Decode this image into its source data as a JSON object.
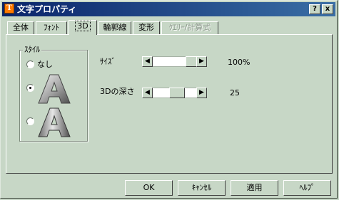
{
  "window": {
    "title": "文字プロパティ",
    "icon_name": "app-text-icon",
    "help_btn": "?",
    "close_btn": "x"
  },
  "tabs": [
    {
      "label": "全体"
    },
    {
      "label": "ﾌｫﾝﾄ"
    },
    {
      "label": "3D",
      "active": true
    },
    {
      "label": "輪郭線"
    },
    {
      "label": "変形"
    },
    {
      "label": "ｸｴﾘｰ/計算式",
      "disabled": true
    }
  ],
  "style_group": {
    "label": "ｽﾀｲﾙ",
    "options": [
      {
        "label": "なし",
        "selected": false
      },
      {
        "label": "",
        "selected": true,
        "icon_name": "3d-a-raised-icon"
      },
      {
        "label": "",
        "selected": false,
        "icon_name": "3d-a-beveled-icon"
      }
    ]
  },
  "size": {
    "label": "ｻｲｽﾞ",
    "value_text": "100%",
    "value": 100
  },
  "depth": {
    "label": "3Dの深さ",
    "value_text": "25",
    "value": 25
  },
  "buttons": {
    "ok": "OK",
    "cancel": "ｷｬﾝｾﾙ",
    "apply": "適用",
    "help": "ﾍﾙﾌﾟ"
  },
  "colors": {
    "face": "#c7d7c6",
    "title_start": "#0a246a",
    "title_end": "#3a6ea5"
  }
}
